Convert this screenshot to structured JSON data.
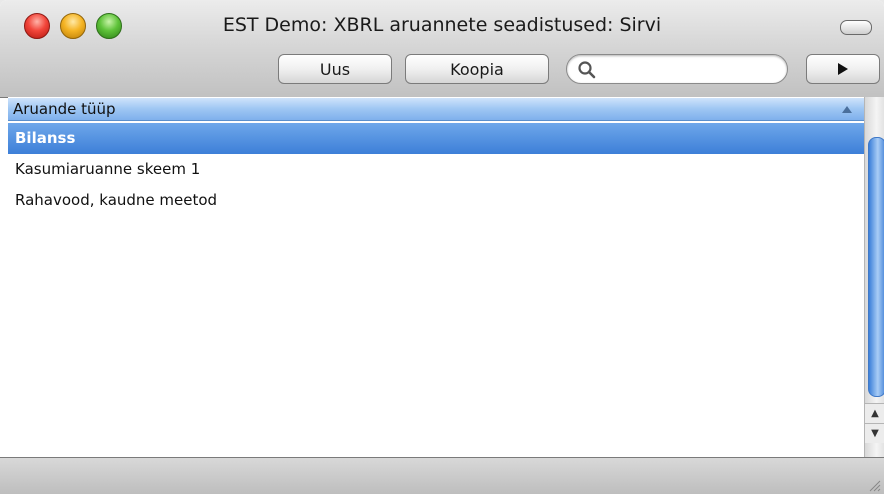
{
  "window": {
    "title": "EST Demo: XBRL aruannete seadistused: Sirvi"
  },
  "toolbar": {
    "new_label": "Uus",
    "copy_label": "Koopia",
    "search_placeholder": "",
    "search_value": "",
    "next_icon": "play-triangle-icon"
  },
  "list": {
    "column_header": "Aruande tüüp",
    "sort_icon": "sort-ascending-icon",
    "rows": [
      {
        "label": "Bilanss",
        "selected": true
      },
      {
        "label": "Kasumiaruanne skeem 1",
        "selected": false
      },
      {
        "label": "Rahavood, kaudne meetod",
        "selected": false
      }
    ]
  },
  "colors": {
    "selection": "#3d7fd8",
    "header": "#9ec6f3"
  }
}
